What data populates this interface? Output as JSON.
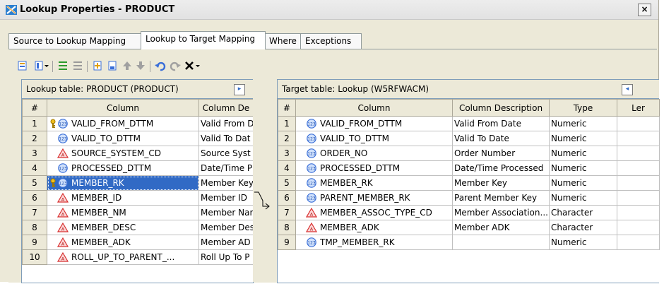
{
  "window": {
    "title": "Lookup Properties - PRODUCT",
    "close_label": "×"
  },
  "tabs": [
    {
      "label": "Source to Lookup Mapping",
      "active": false
    },
    {
      "label": "Lookup to Target Mapping",
      "active": true
    },
    {
      "label": "Where",
      "active": false
    },
    {
      "label": "Exceptions",
      "active": false
    }
  ],
  "toolbar": {
    "icons": [
      "import-icon",
      "columns-dropdown-icon",
      "dropdown-arrow-icon",
      "map-columns-icon",
      "unmap-columns-icon",
      "new-column-icon",
      "properties-icon",
      "move-up-icon",
      "move-down-icon",
      "undo-icon",
      "redo-icon",
      "delete-icon",
      "delete-dropdown-icon"
    ]
  },
  "lookup_panel": {
    "title": "Lookup table: PRODUCT (PRODUCT)",
    "headers": [
      "#",
      "Column",
      "Column De"
    ],
    "rows": [
      {
        "num": "1",
        "name": "VALID_FROM_DTTM",
        "desc": "Valid From D",
        "type": "numeric",
        "key": true
      },
      {
        "num": "2",
        "name": "VALID_TO_DTTM",
        "desc": "Valid To Dat",
        "type": "numeric",
        "key": false
      },
      {
        "num": "3",
        "name": "SOURCE_SYSTEM_CD",
        "desc": "Source Syst",
        "type": "character",
        "key": false
      },
      {
        "num": "4",
        "name": "PROCESSED_DTTM",
        "desc": "Date/Time P",
        "type": "numeric",
        "key": false
      },
      {
        "num": "5",
        "name": "MEMBER_RK",
        "desc": "Member Key",
        "type": "numeric",
        "key": true,
        "selected": true
      },
      {
        "num": "6",
        "name": "MEMBER_ID",
        "desc": "Member ID",
        "type": "character",
        "key": false
      },
      {
        "num": "7",
        "name": "MEMBER_NM",
        "desc": "Member Nar",
        "type": "character",
        "key": false
      },
      {
        "num": "8",
        "name": "MEMBER_DESC",
        "desc": "Member Des",
        "type": "character",
        "key": false
      },
      {
        "num": "9",
        "name": "MEMBER_ADK",
        "desc": "Member AD",
        "type": "character",
        "key": false
      },
      {
        "num": "10",
        "name": "ROLL_UP_TO_PARENT_...",
        "desc": "Roll Up To P",
        "type": "character",
        "key": false
      }
    ]
  },
  "target_panel": {
    "title": "Target table: Lookup (W5RFWACM)",
    "headers": [
      "#",
      "Column",
      "Column Description",
      "Type",
      "Ler"
    ],
    "rows": [
      {
        "num": "1",
        "name": "VALID_FROM_DTTM",
        "desc": "Valid From Date",
        "type_label": "Numeric",
        "type": "numeric"
      },
      {
        "num": "2",
        "name": "VALID_TO_DTTM",
        "desc": "Valid To Date",
        "type_label": "Numeric",
        "type": "numeric"
      },
      {
        "num": "3",
        "name": "ORDER_NO",
        "desc": "Order Number",
        "type_label": "Numeric",
        "type": "numeric"
      },
      {
        "num": "4",
        "name": "PROCESSED_DTTM",
        "desc": "Date/Time Processed",
        "type_label": "Numeric",
        "type": "numeric"
      },
      {
        "num": "5",
        "name": "MEMBER_RK",
        "desc": "Member Key",
        "type_label": "Numeric",
        "type": "numeric"
      },
      {
        "num": "6",
        "name": "PARENT_MEMBER_RK",
        "desc": "Parent Member Key",
        "type_label": "Numeric",
        "type": "numeric"
      },
      {
        "num": "7",
        "name": "MEMBER_ASSOC_TYPE_CD",
        "desc": "Member Association...",
        "type_label": "Character",
        "type": "character"
      },
      {
        "num": "8",
        "name": "MEMBER_ADK",
        "desc": "Member ADK",
        "type_label": "Character",
        "type": "character"
      },
      {
        "num": "9",
        "name": "TMP_MEMBER_RK",
        "desc": "",
        "type_label": "Numeric",
        "type": "numeric"
      }
    ]
  },
  "mapping": {
    "from_row": "5",
    "to_row": "6"
  },
  "colors": {
    "selection": "#316ac5",
    "numeric_icon": "#3a6fd8",
    "character_icon": "#d83030",
    "key_icon": "#d4a000"
  }
}
